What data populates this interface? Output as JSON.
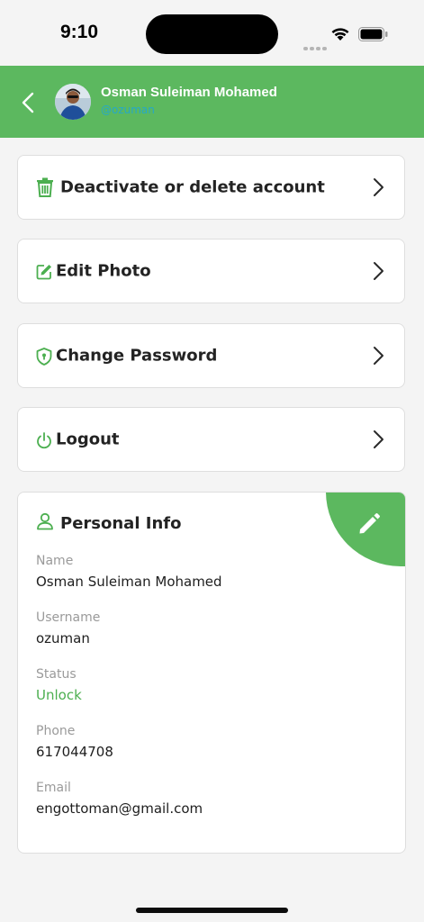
{
  "status_bar": {
    "time": "9:10"
  },
  "header": {
    "name": "Osman Suleiman Mohamed",
    "username": "@ozuman"
  },
  "menu": [
    {
      "label": "Deactivate or delete account",
      "icon": "trash-icon"
    },
    {
      "label": "Edit Photo",
      "icon": "edit-square-icon"
    },
    {
      "label": "Change Password",
      "icon": "shield-lock-icon"
    },
    {
      "label": "Logout",
      "icon": "power-icon"
    }
  ],
  "personal_info": {
    "title": "Personal Info",
    "fields": [
      {
        "label": "Name",
        "value": "Osman Suleiman Mohamed"
      },
      {
        "label": "Username",
        "value": "ozuman"
      },
      {
        "label": "Status",
        "value": "Unlock"
      },
      {
        "label": "Phone",
        "value": "617044708"
      },
      {
        "label": "Email",
        "value": "engottoman@gmail.com"
      }
    ]
  },
  "colors": {
    "accent": "#5cb85f",
    "status_unlock": "#4caf50",
    "username_link": "#25a8c8"
  }
}
